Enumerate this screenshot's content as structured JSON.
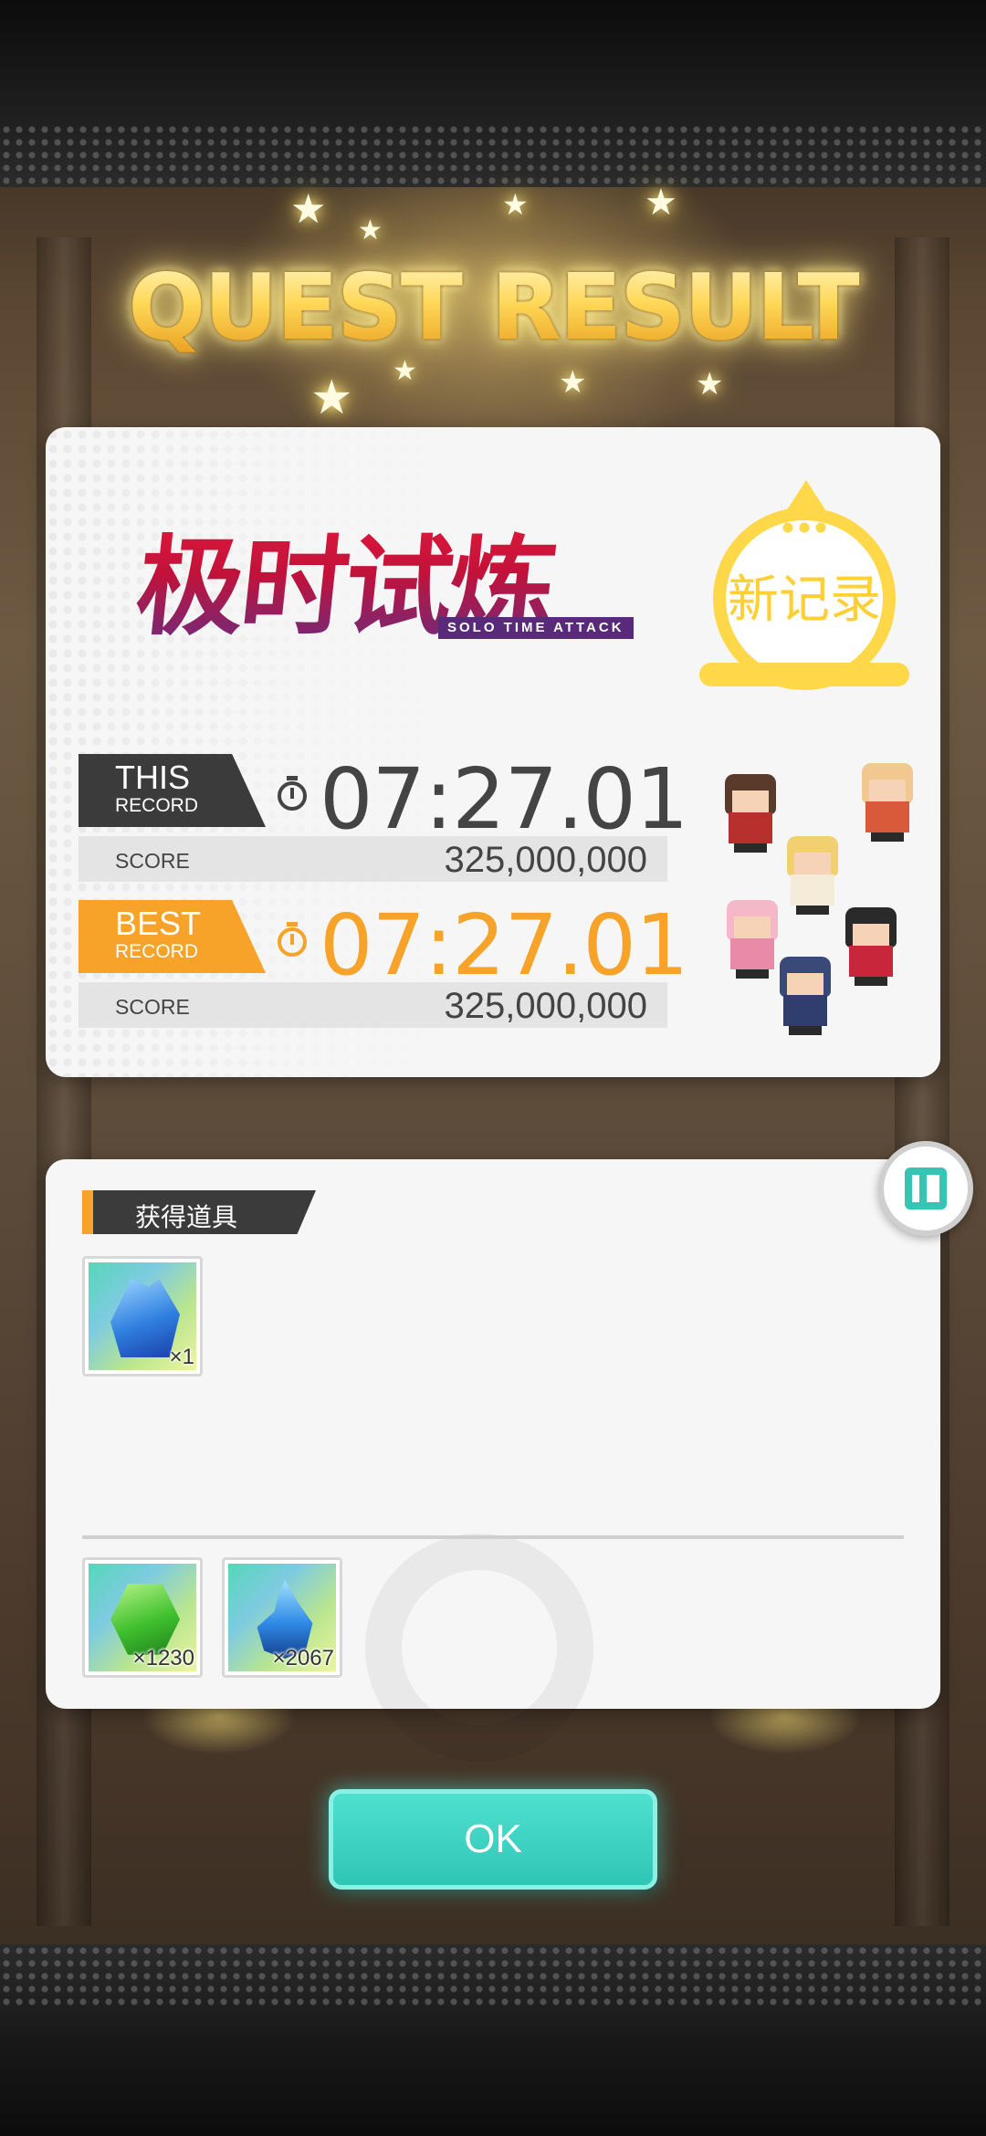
{
  "header": {
    "title": "QUEST RESULT"
  },
  "event": {
    "title_cn": "极时试炼",
    "subtitle_en": "SOLO TIME ATTACK"
  },
  "new_record_badge": "新记录",
  "records": {
    "this": {
      "label_top": "THIS",
      "label_bottom": "RECORD",
      "time": "07:27.01",
      "score_label": "SCORE",
      "score": "325,000,000"
    },
    "best": {
      "label_top": "BEST",
      "label_bottom": "RECORD",
      "time": "07:27.01",
      "score_label": "SCORE",
      "score": "325,000,000"
    }
  },
  "items_section": {
    "title": "获得道具",
    "obtained": [
      {
        "icon": "blue-crystal-icon",
        "qty": "×1"
      }
    ],
    "currencies": [
      {
        "icon": "green-gem-icon",
        "qty": "×1230"
      },
      {
        "icon": "blue-flame-icon",
        "qty": "×2067"
      }
    ]
  },
  "ok_button": {
    "label": "OK"
  },
  "colors": {
    "accent_orange": "#f7a229",
    "accent_teal": "#34c5b5",
    "title_gold": "#ffd54a",
    "dark_tag": "#3b3b3b"
  }
}
